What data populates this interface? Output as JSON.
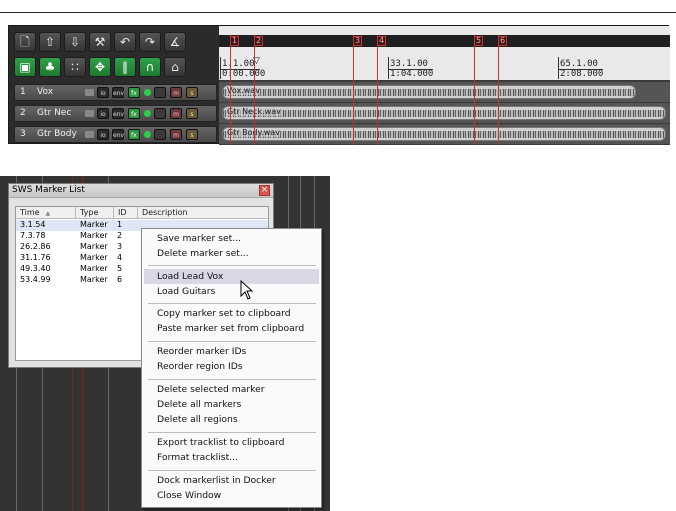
{
  "toolbar": {
    "row1_icons": [
      "new-project-icon",
      "open-project-icon",
      "save-project-icon",
      "settings-wrench-icon",
      "undo-icon",
      "redo-icon",
      "metronome-icon"
    ],
    "row2_icons": [
      "image-icon",
      "clover-icon",
      "grid-icon",
      "snap-icon",
      "columns-icon",
      "magnet-icon",
      "lock-icon"
    ]
  },
  "tracks": [
    {
      "num": "1",
      "name": "Vox"
    },
    {
      "num": "2",
      "name": "Gtr Nec"
    },
    {
      "num": "3",
      "name": "Gtr Body"
    }
  ],
  "track_buttons": {
    "io": "io",
    "env": "env",
    "fx": "fx",
    "m": "m",
    "s": "s"
  },
  "markers": [
    "1",
    "2",
    "3",
    "4",
    "5",
    "6"
  ],
  "ruler": [
    {
      "measure": "1.1.00",
      "time": "0:00.000"
    },
    {
      "measure": "33.1.00",
      "time": "1:04.000"
    },
    {
      "measure": "65.1.00",
      "time": "2:08.000"
    }
  ],
  "items": [
    {
      "label": "Vox.wav"
    },
    {
      "label": "Gtr Neck.wav"
    },
    {
      "label": "Gtr Body.wav"
    }
  ],
  "sws": {
    "title": "SWS Marker List",
    "columns": [
      "Time",
      "Type",
      "ID",
      "Description"
    ],
    "rows": [
      {
        "time": "3.1.54",
        "type": "Marker",
        "id": "1",
        "desc": ""
      },
      {
        "time": "7.3.78",
        "type": "Marker",
        "id": "2",
        "desc": ""
      },
      {
        "time": "26.2.86",
        "type": "Marker",
        "id": "3",
        "desc": ""
      },
      {
        "time": "31.1.76",
        "type": "Marker",
        "id": "4",
        "desc": ""
      },
      {
        "time": "49.3.40",
        "type": "Marker",
        "id": "5",
        "desc": ""
      },
      {
        "time": "53.4.99",
        "type": "Marker",
        "id": "6",
        "desc": ""
      }
    ]
  },
  "menu": {
    "items": [
      "Save marker set...",
      "Delete marker set...",
      "Load Lead Vox",
      "Load Guitars",
      "Copy marker set to clipboard",
      "Paste marker set from clipboard",
      "Reorder marker IDs",
      "Reorder region IDs",
      "Delete selected marker",
      "Delete all markers",
      "Delete all regions",
      "Export tracklist to clipboard",
      "Format tracklist...",
      "Dock markerlist in Docker",
      "Close Window"
    ],
    "highlighted": "Load Lead Vox"
  },
  "colors": {
    "marker": "#c83232",
    "fx_green": "#2a9a42",
    "menu_highlight": "#d7d7e6"
  }
}
